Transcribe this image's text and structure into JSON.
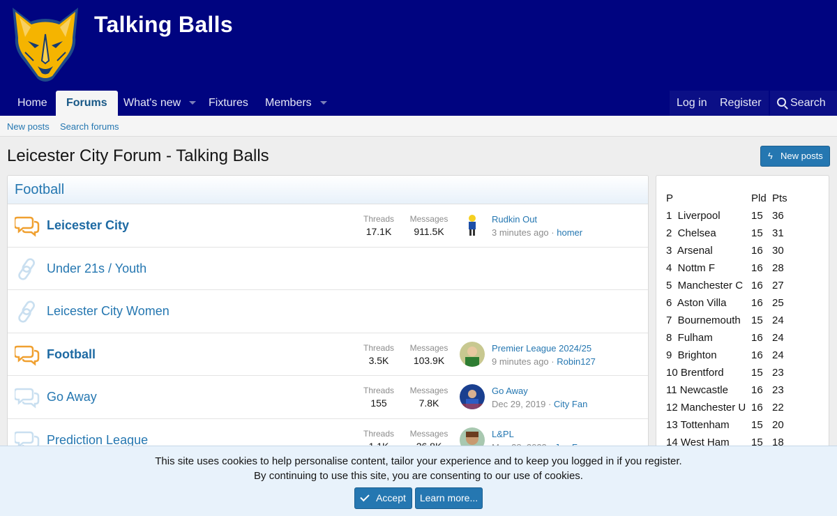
{
  "site": {
    "title": "Talking Balls",
    "logo_icon": "fox-head-logo",
    "colors": {
      "header": "#000480",
      "link": "#2577b1",
      "accent_orange": "#f0a030",
      "logo_yellow": "#f5b400"
    }
  },
  "nav": {
    "tabs": [
      {
        "label": "Home",
        "has_caret": false
      },
      {
        "label": "Forums",
        "active": true
      },
      {
        "label": "What's new",
        "has_caret": true
      },
      {
        "label": "Fixtures",
        "has_caret": false
      },
      {
        "label": "Members",
        "has_caret": true
      }
    ],
    "login": "Log in",
    "register": "Register",
    "search": "Search"
  },
  "subnav": {
    "new_posts": "New posts",
    "search_forums": "Search forums"
  },
  "page": {
    "title": "Leicester City Forum - Talking Balls",
    "new_posts_button": "New posts"
  },
  "category": {
    "title": "Football"
  },
  "nodes": [
    {
      "title": "Leicester City",
      "bold": true,
      "icon": "chat-bubbles-icon-unread",
      "threads_label": "Threads",
      "threads": "17.1K",
      "messages_label": "Messages",
      "messages": "911.5K",
      "last_title": "Rudkin Out",
      "last_time": "3 minutes ago",
      "last_user": "homer"
    },
    {
      "title": "Under 21s / Youth",
      "bold": false,
      "icon": "link-icon"
    },
    {
      "title": "Leicester City Women",
      "bold": false,
      "icon": "link-icon"
    },
    {
      "title": "Football",
      "bold": true,
      "icon": "chat-bubbles-icon-unread",
      "threads_label": "Threads",
      "threads": "3.5K",
      "messages_label": "Messages",
      "messages": "103.9K",
      "last_title": "Premier League 2024/25",
      "last_time": "9 minutes ago",
      "last_user": "Robin127"
    },
    {
      "title": "Go Away",
      "bold": false,
      "icon": "chat-bubbles-icon-read",
      "threads_label": "Threads",
      "threads": "155",
      "messages_label": "Messages",
      "messages": "7.8K",
      "last_title": "Go Away",
      "last_time": "Dec 29, 2019",
      "last_user": "City Fan"
    },
    {
      "title": "Prediction League",
      "bold": false,
      "icon": "chat-bubbles-icon-read",
      "threads_label": "Threads",
      "threads": "1.1K",
      "messages_label": "Messages",
      "messages": "26.8K",
      "last_title": "L&PL",
      "last_time": "May 28, 2023",
      "last_user": "Joe Fox"
    }
  ],
  "league_table": {
    "headers": {
      "pos": "P",
      "pld": "Pld",
      "pts": "Pts"
    },
    "rows": [
      {
        "team": "1  Liverpool",
        "pld": "15",
        "pts": "36"
      },
      {
        "team": "2  Chelsea",
        "pld": "15",
        "pts": "31"
      },
      {
        "team": "3  Arsenal",
        "pld": "16",
        "pts": "30"
      },
      {
        "team": "4  Nottm F",
        "pld": "16",
        "pts": "28"
      },
      {
        "team": "5  Manchester C",
        "pld": "16",
        "pts": "27"
      },
      {
        "team": "6  Aston Villa",
        "pld": "16",
        "pts": "25"
      },
      {
        "team": "7  Bournemouth",
        "pld": "15",
        "pts": "24"
      },
      {
        "team": "8  Fulham",
        "pld": "16",
        "pts": "24"
      },
      {
        "team": "9  Brighton",
        "pld": "16",
        "pts": "24"
      },
      {
        "team": "10 Brentford",
        "pld": "15",
        "pts": "23"
      },
      {
        "team": "11 Newcastle",
        "pld": "16",
        "pts": "23"
      },
      {
        "team": "12 Manchester U",
        "pld": "16",
        "pts": "22"
      },
      {
        "team": "13 Tottenham",
        "pld": "15",
        "pts": "20"
      },
      {
        "team": "14 West Ham",
        "pld": "15",
        "pts": "18"
      }
    ]
  },
  "cookie_notice": {
    "line1": "This site uses cookies to help personalise content, tailor your experience and to keep you logged in if you register.",
    "line2": "By continuing to use this site, you are consenting to our use of cookies.",
    "accept": "Accept",
    "learn_more": "Learn more..."
  }
}
